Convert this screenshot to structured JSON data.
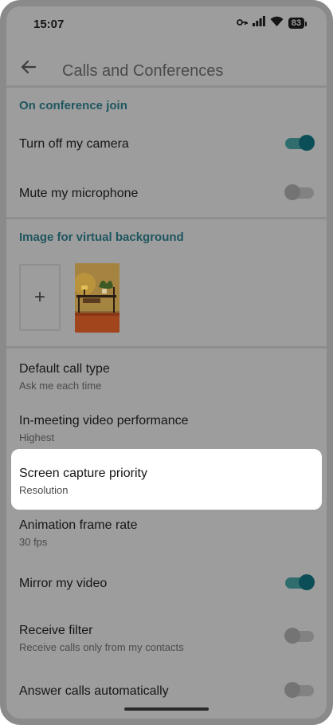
{
  "status": {
    "time": "15:07",
    "battery": "83"
  },
  "header": {
    "title": "Calls and Conferences"
  },
  "sections": {
    "conference_join": "On conference join",
    "virtual_background": "Image for virtual background",
    "add_symbol": "+"
  },
  "settings": {
    "camera_off": {
      "label": "Turn off my camera",
      "enabled": true
    },
    "mute_mic": {
      "label": "Mute my microphone",
      "enabled": false
    },
    "call_type": {
      "label": "Default call type",
      "value": "Ask me each time"
    },
    "video_perf": {
      "label": "In-meeting video performance",
      "value": "Highest"
    },
    "screen_capture": {
      "label": "Screen capture priority",
      "value": "Resolution"
    },
    "frame_rate": {
      "label": "Animation frame rate",
      "value": "30 fps"
    },
    "mirror": {
      "label": "Mirror my video",
      "enabled": true
    },
    "receive_filter": {
      "label": "Receive filter",
      "value": "Receive calls only from my contacts",
      "enabled": false
    },
    "answer_auto": {
      "label": "Answer calls automatically",
      "enabled": false
    }
  },
  "colors": {
    "accent": "#0c4e57",
    "section": "#1f5660",
    "dim_overlay": "#9d9d9d"
  }
}
